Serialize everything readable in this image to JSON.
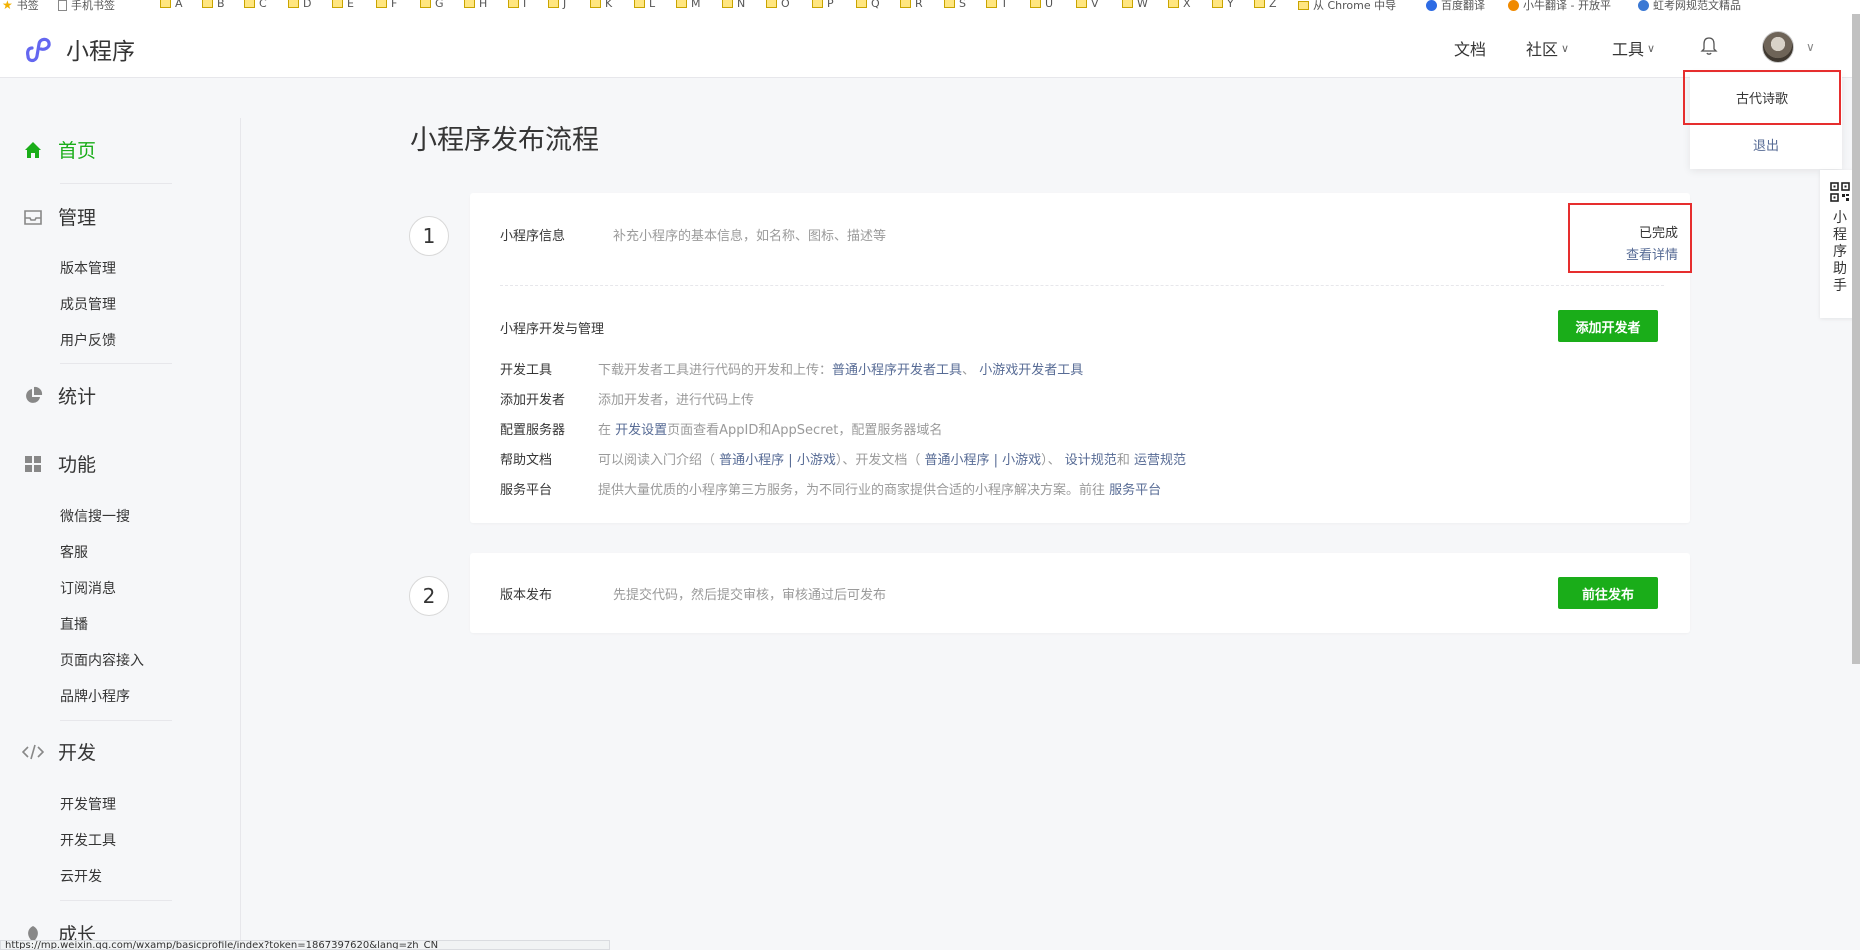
{
  "bookmarks": {
    "items": [
      "书签",
      "手机书签",
      "A",
      "B",
      "C",
      "D",
      "E",
      "F",
      "G",
      "H",
      "I",
      "J",
      "K",
      "L",
      "M",
      "N",
      "O",
      "P",
      "Q",
      "R",
      "S",
      "T",
      "U",
      "V",
      "W",
      "X",
      "Y",
      "Z",
      "从 Chrome 中导",
      "百度翻译",
      "小牛翻译 - 开放平",
      "虹考网规范文精品"
    ]
  },
  "header": {
    "logo_text": "小程序",
    "nav": [
      {
        "label": "文档"
      },
      {
        "label": "社区"
      },
      {
        "label": "工具"
      }
    ]
  },
  "dropdown": {
    "items": [
      "古代诗歌",
      "退出"
    ]
  },
  "sidebar": {
    "sections": [
      {
        "label": "首页",
        "items": []
      },
      {
        "label": "管理",
        "items": [
          "版本管理",
          "成员管理",
          "用户反馈"
        ]
      },
      {
        "label": "统计",
        "items": []
      },
      {
        "label": "功能",
        "items": [
          "微信搜一搜",
          "客服",
          "订阅消息",
          "直播",
          "页面内容接入",
          "品牌小程序"
        ]
      },
      {
        "label": "开发",
        "items": [
          "开发管理",
          "开发工具",
          "云开发"
        ]
      },
      {
        "label": "成长",
        "items": []
      }
    ]
  },
  "main": {
    "title": "小程序发布流程",
    "step1": {
      "number": "1",
      "title": "小程序信息",
      "desc": "补充小程序的基本信息，如名称、图标、描述等",
      "status": "已完成",
      "status_link": "查看详情",
      "section_title": "小程序开发与管理",
      "add_dev_button": "添加开发者",
      "rows": {
        "r1": {
          "label": "开发工具",
          "text": "下载开发者工具进行代码的开发和上传：",
          "link1": "普通小程序开发者工具",
          "sep": "、",
          "link2": "小游戏开发者工具"
        },
        "r2": {
          "label": "添加开发者",
          "text": "添加开发者，进行代码上传"
        },
        "r3": {
          "label": "配置服务器",
          "pre": "在 ",
          "link": "开发设置",
          "post": "页面查看AppID和AppSecret，配置服务器域名"
        },
        "r4": {
          "label": "帮助文档",
          "t1": "可以阅读入门介绍（ ",
          "l1": "普通小程序",
          "s1": " | ",
          "l2": "小游戏",
          "t2": "）、开发文档（ ",
          "l3": "普通小程序",
          "s2": " | ",
          "l4": "小游戏",
          "t3": "）、 ",
          "l5": "设计规范",
          "t4": "和 ",
          "l6": "运营规范"
        },
        "r5": {
          "label": "服务平台",
          "text": "提供大量优质的小程序第三方服务，为不同行业的商家提供合适的小程序解决方案。前往 ",
          "link": "服务平台"
        }
      }
    },
    "step2": {
      "number": "2",
      "title": "版本发布",
      "desc": "先提交代码，然后提交审核，审核通过后可发布",
      "button": "前往发布"
    }
  },
  "helper": {
    "label": "小程序助手"
  },
  "statusbar": {
    "url": "https://mp.weixin.qq.com/wxamp/basicprofile/index?token=1867397620&lang=zh_CN"
  },
  "colors": {
    "accent": "#1aad19",
    "link": "#576b95",
    "highlight": "#e62e2e"
  }
}
